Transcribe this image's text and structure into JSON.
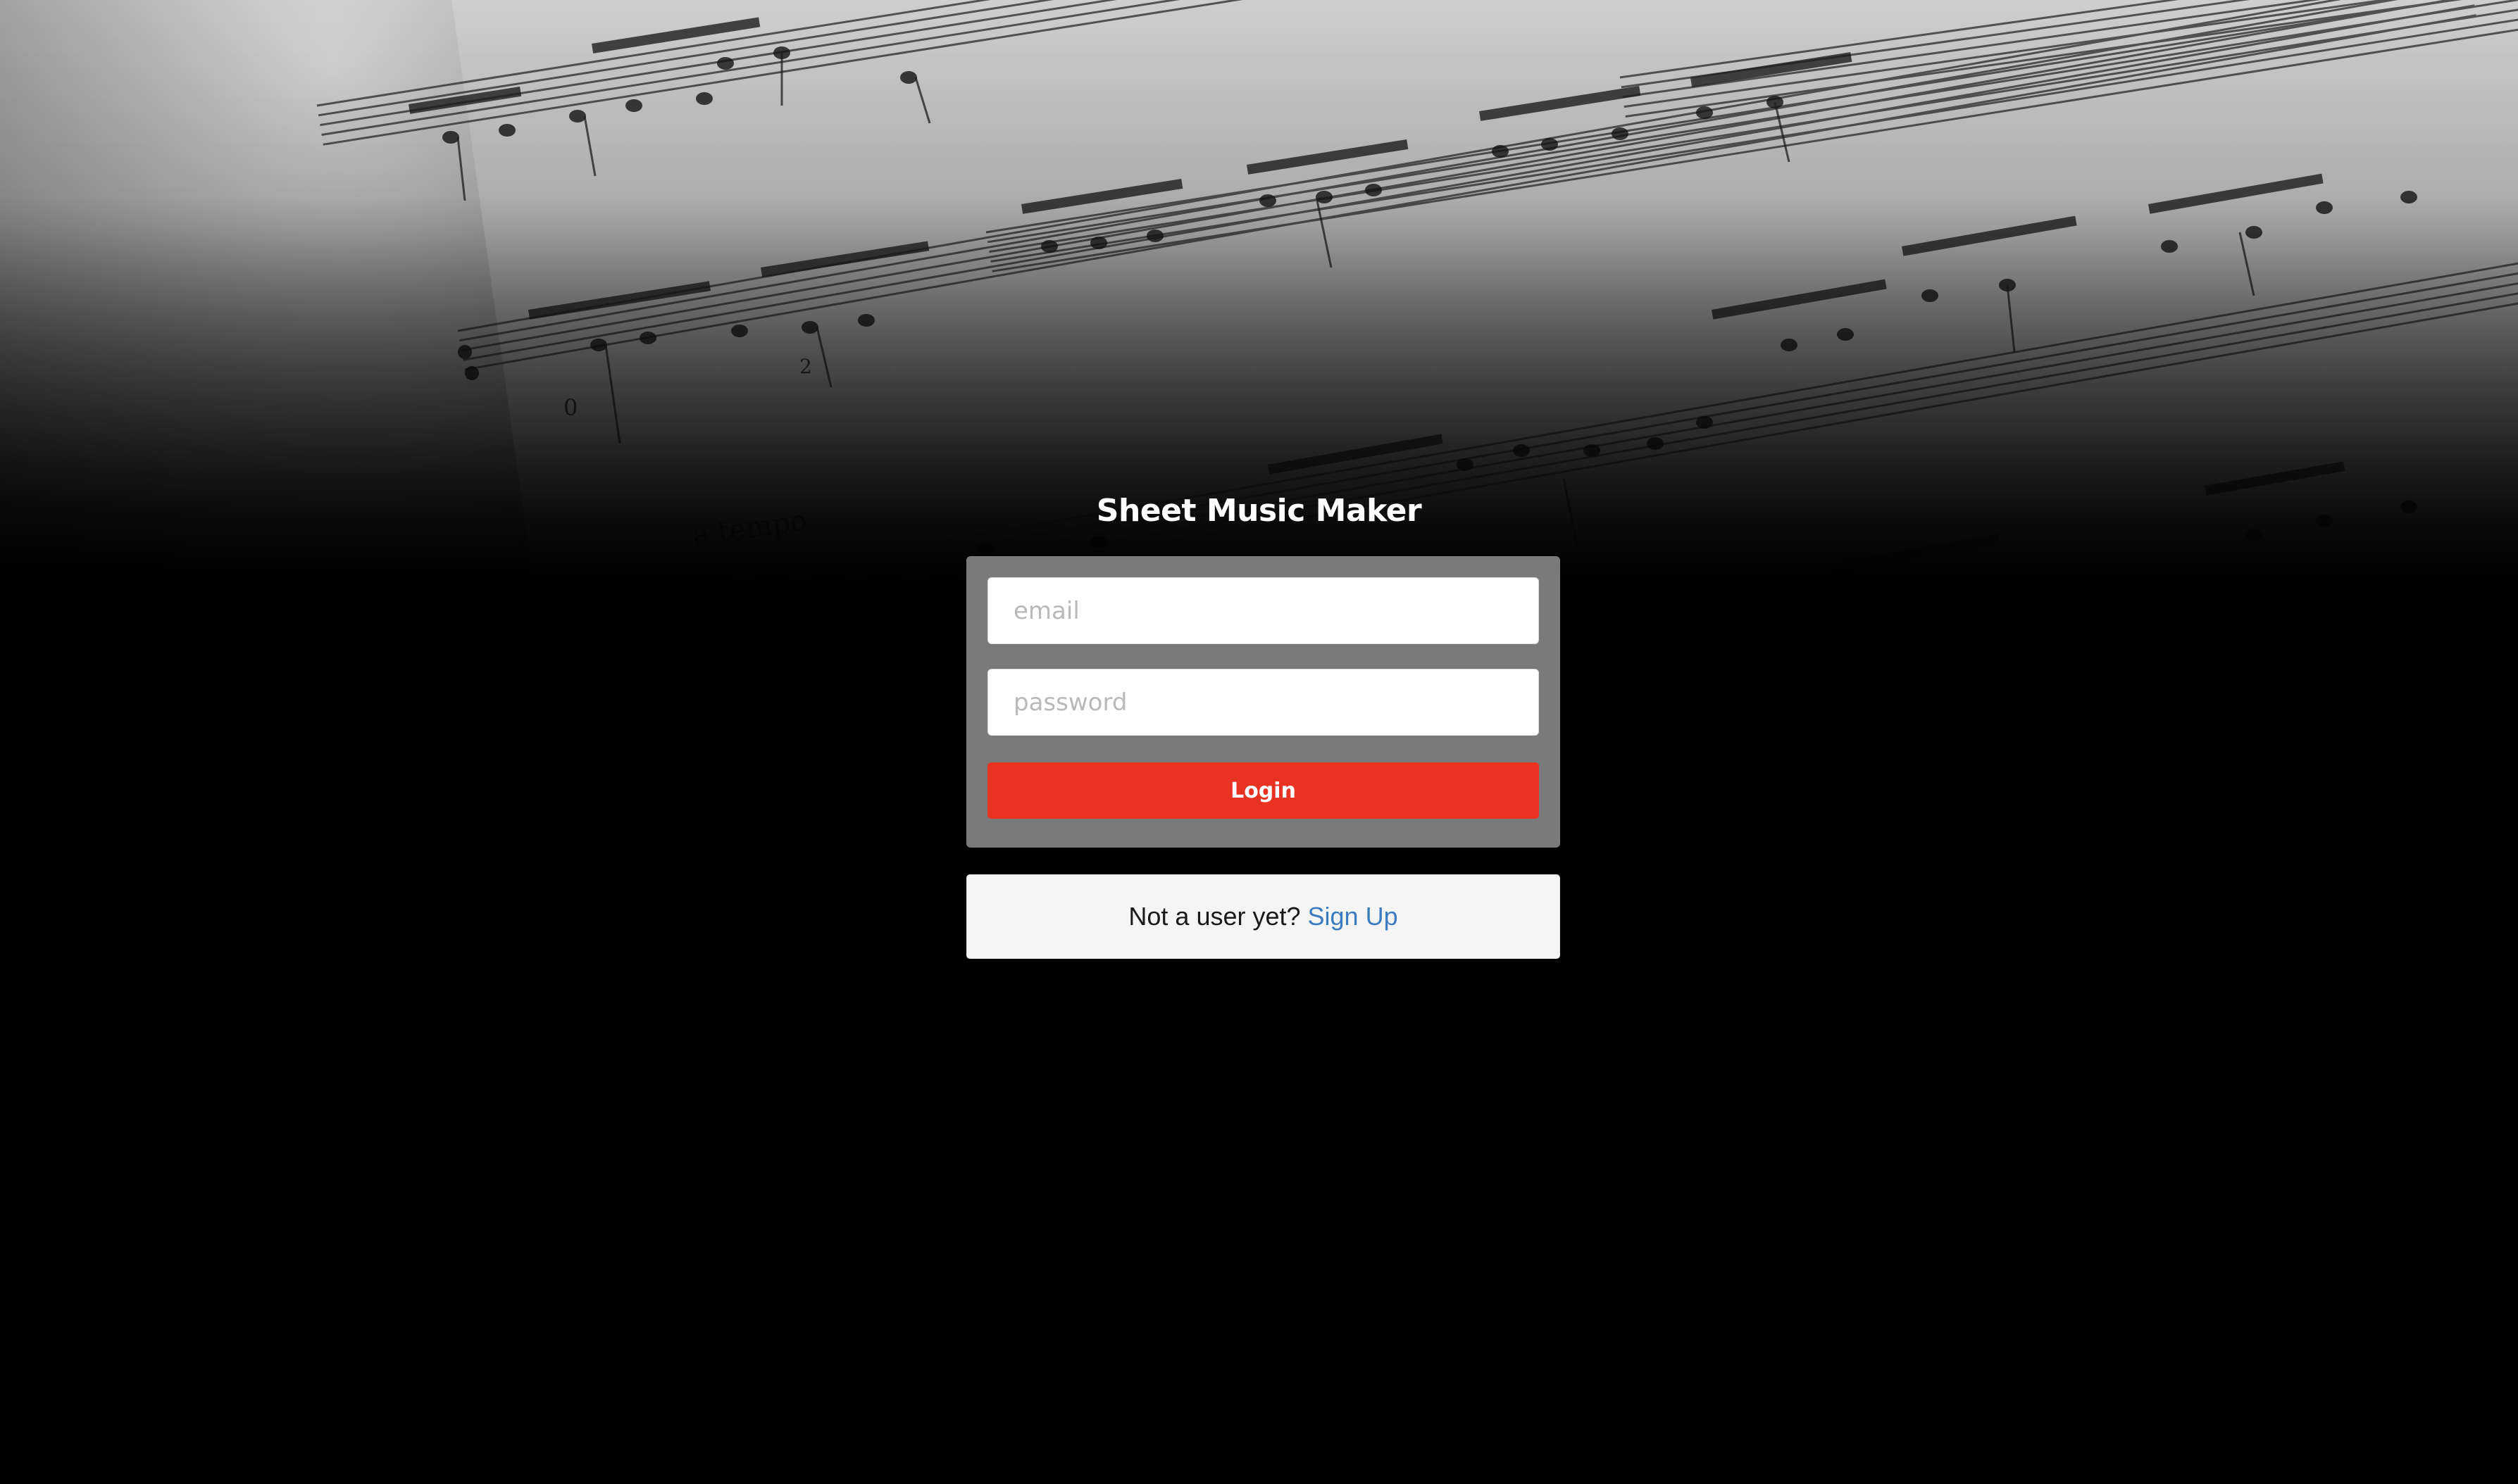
{
  "app": {
    "title": "Sheet Music Maker"
  },
  "login_form": {
    "email_placeholder": "email",
    "password_placeholder": "password",
    "login_label": "Login"
  },
  "signup": {
    "prompt": "Not a user yet?",
    "link_label": "Sign Up"
  },
  "background": {
    "image": "sheet-music-photo",
    "text_visible": "a tempo"
  },
  "colors": {
    "page_background": "#000000",
    "panel": "#7a7a7a",
    "login_button": "#e83323",
    "link": "#3b7bbf",
    "signup_box": "#f5f5f5"
  }
}
